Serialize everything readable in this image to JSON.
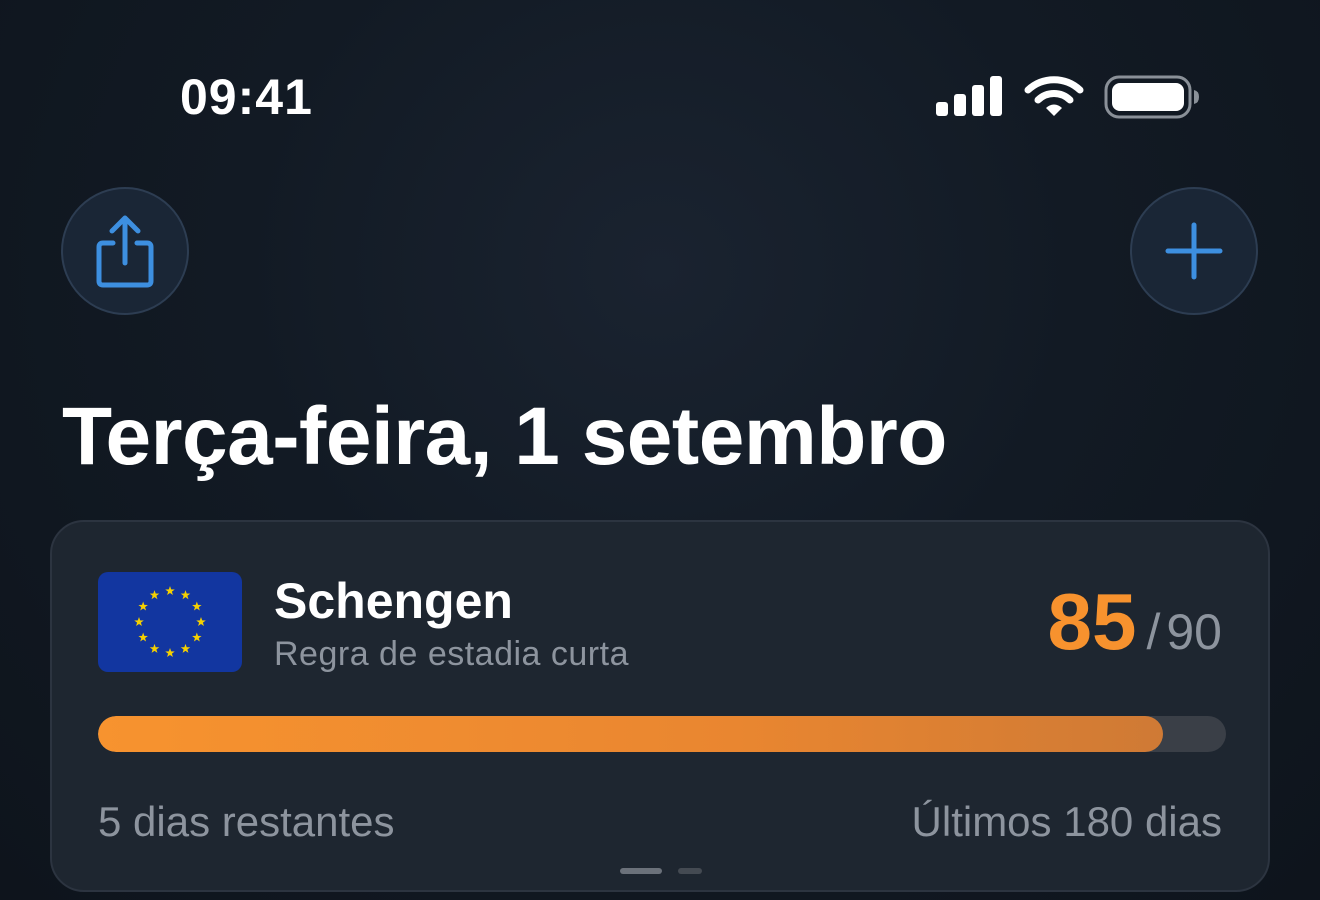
{
  "status_bar": {
    "time": "09:41",
    "signal_icon": "cellular-signal-icon",
    "wifi_icon": "wifi-icon",
    "battery_icon": "battery-full-icon"
  },
  "toolbar": {
    "share_icon": "share-icon",
    "add_icon": "plus-icon",
    "accent_color": "#3d8fe0"
  },
  "header": {
    "date_title": "Terça-feira, 1 setembro"
  },
  "card": {
    "flag_icon": "eu-flag-icon",
    "zone_name": "Schengen",
    "rule": "Regra de estadia curta",
    "days_used": "85",
    "separator": "/",
    "days_max": "90",
    "progress_fraction": 0.9444,
    "remaining": "5 dias restantes",
    "window": "Últimos 180 dias",
    "accent_color": "#f7922e",
    "pager": {
      "count": 2,
      "active_index": 0
    }
  }
}
